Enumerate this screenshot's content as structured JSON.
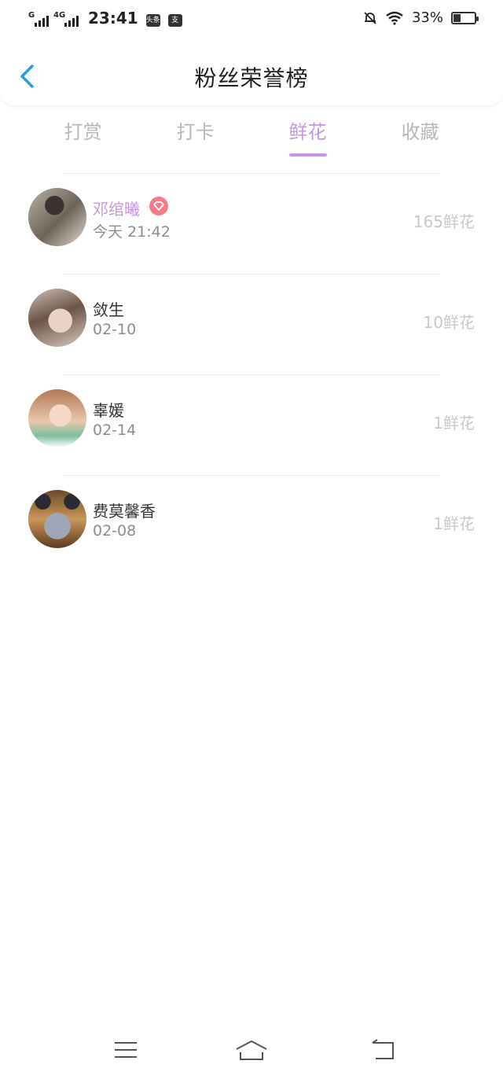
{
  "status_bar": {
    "signal1_label": "G",
    "signal2_label": "4G",
    "time": "23:41",
    "notif1": "头条",
    "notif2": "支",
    "battery_percent": "33%",
    "battery_level": 0.33
  },
  "header": {
    "title": "粉丝荣誉榜"
  },
  "tabs": [
    {
      "label": "打赏",
      "active": false
    },
    {
      "label": "打卡",
      "active": false
    },
    {
      "label": "鲜花",
      "active": true
    },
    {
      "label": "收藏",
      "active": false
    }
  ],
  "fans": [
    {
      "name": "邓绾曦",
      "vip": true,
      "time": "今天 21:42",
      "count": "165鲜花"
    },
    {
      "name": "敛生",
      "vip": false,
      "time": "02-10",
      "count": "10鲜花"
    },
    {
      "name": "辜媛",
      "vip": false,
      "time": "02-14",
      "count": "1鲜花"
    },
    {
      "name": "费莫馨香",
      "vip": false,
      "time": "02-08",
      "count": "1鲜花"
    }
  ],
  "colors": {
    "accent": "#c696e6",
    "back_arrow": "#2aa0e0",
    "vip_badge": "#f67b87"
  }
}
